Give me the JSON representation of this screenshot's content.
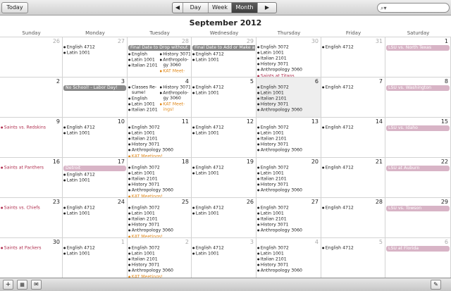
{
  "toolbar": {
    "today_label": "Today",
    "nav_prev": "◀",
    "nav_next": "▶",
    "views": [
      "Day",
      "Week",
      "Month"
    ],
    "selected_view": "Month",
    "search_placeholder": ""
  },
  "calendar": {
    "title": "September 2012",
    "weekdays": [
      "Sunday",
      "Monday",
      "Tuesday",
      "Wednesday",
      "Thursday",
      "Friday",
      "Saturday"
    ],
    "weeks": [
      [
        {
          "day": "26",
          "other": true,
          "events": []
        },
        {
          "day": "27",
          "other": true,
          "events": [
            {
              "t": "English 4712"
            },
            {
              "t": "Latin 1001"
            }
          ]
        },
        {
          "day": "28",
          "other": true,
          "allday": [
            {
              "t": "Final Date to Drop without",
              "c": "gray",
              "ext": true
            }
          ],
          "left": [
            {
              "t": "English"
            },
            {
              "t": "Latin 1001"
            },
            {
              "t": "Italian 2101"
            }
          ],
          "right": [
            {
              "t": "History 3071"
            },
            {
              "t": "Anthropolo-",
              "nodot": false
            },
            {
              "t": "gy 3060",
              "nodot": true
            },
            {
              "t": "KAT Meet-",
              "c": "orange"
            }
          ]
        },
        {
          "day": "29",
          "other": true,
          "allday": [
            {
              "t": "Final Date to Add or Make a",
              "c": "gray",
              "ext": true
            }
          ],
          "events": [
            {
              "t": "English 4712"
            },
            {
              "t": "Latin 1001"
            }
          ]
        },
        {
          "day": "30",
          "other": true,
          "events": [
            {
              "t": "English 3072"
            },
            {
              "t": "Latin 1001"
            },
            {
              "t": "Italian 2101"
            },
            {
              "t": "History 3071"
            },
            {
              "t": "Anthropology 3060"
            },
            {
              "t": "Saints at Titans",
              "c": "red"
            }
          ]
        },
        {
          "day": "31",
          "other": true,
          "events": [
            {
              "t": "English 4712"
            }
          ]
        },
        {
          "day": "1",
          "other": false,
          "allday": [
            {
              "t": "LSU vs. North Texas",
              "c": "pink"
            }
          ],
          "events": []
        }
      ],
      [
        {
          "day": "2",
          "events": []
        },
        {
          "day": "3",
          "allday": [
            {
              "t": "No School! - Labor Day!",
              "c": "gray"
            }
          ],
          "events": []
        },
        {
          "day": "4",
          "left": [
            {
              "t": "Classes Re-"
            },
            {
              "t": "sume!",
              "nodot": true
            },
            {
              "t": "English"
            },
            {
              "t": "Latin 1001"
            },
            {
              "t": "Italian 2101"
            }
          ],
          "right": [
            {
              "t": "History 3071"
            },
            {
              "t": "Anthropolo-"
            },
            {
              "t": "gy 3060",
              "nodot": true
            },
            {
              "t": "KAT Meet-",
              "c": "orange"
            },
            {
              "t": "ings!",
              "c": "orange",
              "nodot": true
            }
          ]
        },
        {
          "day": "5",
          "events": [
            {
              "t": "English 4712"
            },
            {
              "t": "Latin 1001"
            }
          ]
        },
        {
          "day": "6",
          "today": true,
          "events": [
            {
              "t": "English 3072"
            },
            {
              "t": "Latin 1001"
            },
            {
              "t": "Italian 2101"
            },
            {
              "t": "History 3071"
            },
            {
              "t": "Anthropology 3060"
            }
          ]
        },
        {
          "day": "7",
          "events": [
            {
              "t": "English 4712"
            }
          ]
        },
        {
          "day": "8",
          "allday": [
            {
              "t": "LSU vs. Washington",
              "c": "pink"
            }
          ],
          "events": []
        }
      ],
      [
        {
          "day": "9",
          "events": [
            {
              "t": "Saints vs. Redskins",
              "c": "red"
            }
          ]
        },
        {
          "day": "10",
          "events": [
            {
              "t": "English 4712"
            },
            {
              "t": "Latin 1001"
            }
          ]
        },
        {
          "day": "11",
          "events": [
            {
              "t": "English 3072"
            },
            {
              "t": "Latin 1001"
            },
            {
              "t": "Italian 2101"
            },
            {
              "t": "History 3071"
            },
            {
              "t": "Anthropology 3060"
            },
            {
              "t": "KAT Meetings!",
              "c": "orange"
            }
          ]
        },
        {
          "day": "12",
          "events": [
            {
              "t": "English 4712"
            },
            {
              "t": "Latin 1001"
            }
          ]
        },
        {
          "day": "13",
          "events": [
            {
              "t": "English 3072"
            },
            {
              "t": "Latin 1001"
            },
            {
              "t": "Italian 2101"
            },
            {
              "t": "History 3071"
            },
            {
              "t": "Anthropology 3060"
            }
          ]
        },
        {
          "day": "14",
          "events": [
            {
              "t": "English 4712"
            }
          ]
        },
        {
          "day": "15",
          "allday": [
            {
              "t": "LSU vs. Idaho",
              "c": "pink"
            }
          ],
          "events": []
        }
      ],
      [
        {
          "day": "16",
          "events": [
            {
              "t": "Saints at Panthers",
              "c": "red"
            }
          ]
        },
        {
          "day": "17",
          "allday": [
            {
              "t": "Detroit",
              "c": "pink"
            }
          ],
          "events": [
            {
              "t": "English 4712"
            },
            {
              "t": "Latin 1001"
            }
          ]
        },
        {
          "day": "18",
          "events": [
            {
              "t": "English 3072"
            },
            {
              "t": "Latin 1001"
            },
            {
              "t": "Italian 2101"
            },
            {
              "t": "History 3071"
            },
            {
              "t": "Anthropology 3060"
            },
            {
              "t": "KAT Meetings!",
              "c": "orange"
            }
          ]
        },
        {
          "day": "19",
          "events": [
            {
              "t": "English 4712"
            },
            {
              "t": "Latin 1001"
            }
          ]
        },
        {
          "day": "20",
          "events": [
            {
              "t": "English 3072"
            },
            {
              "t": "Latin 1001"
            },
            {
              "t": "Italian 2101"
            },
            {
              "t": "History 3071"
            },
            {
              "t": "Anthropology 3060"
            }
          ]
        },
        {
          "day": "21",
          "events": [
            {
              "t": "English 4712"
            }
          ]
        },
        {
          "day": "22",
          "allday": [
            {
              "t": "LSU at Auburn",
              "c": "pink"
            }
          ],
          "events": []
        }
      ],
      [
        {
          "day": "23",
          "events": [
            {
              "t": "Saints vs. Chiefs",
              "c": "red"
            }
          ]
        },
        {
          "day": "24",
          "events": [
            {
              "t": "English 4712"
            },
            {
              "t": "Latin 1001"
            }
          ]
        },
        {
          "day": "25",
          "events": [
            {
              "t": "English 3072"
            },
            {
              "t": "Latin 1001"
            },
            {
              "t": "Italian 2101"
            },
            {
              "t": "History 3071"
            },
            {
              "t": "Anthropology 3060"
            },
            {
              "t": "KAT Meetings!",
              "c": "orange"
            }
          ]
        },
        {
          "day": "26",
          "events": [
            {
              "t": "English 4712"
            },
            {
              "t": "Latin 1001"
            }
          ]
        },
        {
          "day": "27",
          "events": [
            {
              "t": "English 3072"
            },
            {
              "t": "Latin 1001"
            },
            {
              "t": "Italian 2101"
            },
            {
              "t": "History 3071"
            },
            {
              "t": "Anthropology 3060"
            }
          ]
        },
        {
          "day": "28",
          "events": [
            {
              "t": "English 4712"
            }
          ]
        },
        {
          "day": "29",
          "allday": [
            {
              "t": "LSU vs. Towson",
              "c": "pink"
            }
          ],
          "events": []
        }
      ],
      [
        {
          "day": "30",
          "events": [
            {
              "t": "Saints at Packers",
              "c": "red"
            }
          ]
        },
        {
          "day": "1",
          "other": true,
          "events": [
            {
              "t": "English 4712"
            },
            {
              "t": "Latin 1001"
            }
          ]
        },
        {
          "day": "2",
          "other": true,
          "events": [
            {
              "t": "English 3072"
            },
            {
              "t": "Latin 1001"
            },
            {
              "t": "Italian 2101"
            },
            {
              "t": "History 3071"
            },
            {
              "t": "Anthropology 3060"
            },
            {
              "t": "KAT Meetings!",
              "c": "orange"
            }
          ]
        },
        {
          "day": "3",
          "other": true,
          "events": [
            {
              "t": "English 4712"
            },
            {
              "t": "Latin 1001"
            }
          ]
        },
        {
          "day": "4",
          "other": true,
          "events": [
            {
              "t": "English 3072"
            },
            {
              "t": "Latin 1001"
            },
            {
              "t": "Italian 2101"
            },
            {
              "t": "History 3071"
            },
            {
              "t": "Anthropology 3060"
            }
          ]
        },
        {
          "day": "5",
          "other": true,
          "events": [
            {
              "t": "English 4712"
            }
          ]
        },
        {
          "day": "6",
          "other": true,
          "allday": [
            {
              "t": "LSU at Florida",
              "c": "pink"
            }
          ],
          "events": []
        }
      ]
    ]
  },
  "bottombar": {
    "add_label": "+",
    "calendars_icon": "calendar-list-icon",
    "invitations_icon": "envelope-icon",
    "pin_icon": "pin-icon"
  },
  "colors": {
    "gray_event": "#8a8a8a",
    "pink_event": "#d8b4c6",
    "red_text": "#b03050",
    "orange_text": "#e08a1e",
    "today_bg": "#eeeeee"
  }
}
